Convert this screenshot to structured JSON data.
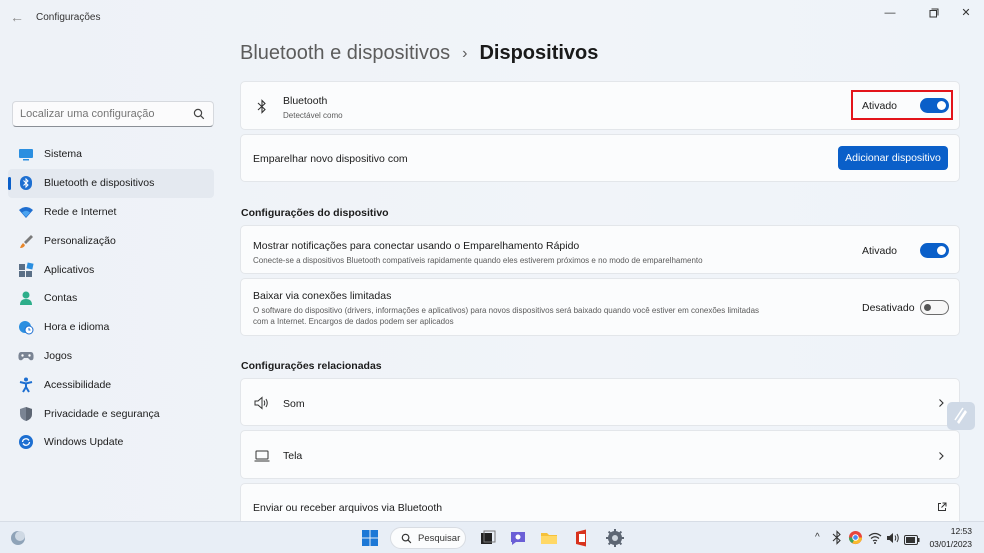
{
  "app": {
    "title": "Configurações"
  },
  "search": {
    "placeholder": "Localizar uma configuração"
  },
  "sidebar": {
    "items": [
      {
        "label": "Sistema",
        "icon": "monitor-icon"
      },
      {
        "label": "Bluetooth e dispositivos",
        "icon": "bluetooth-icon",
        "active": true
      },
      {
        "label": "Rede e Internet",
        "icon": "wifi-icon"
      },
      {
        "label": "Personalização",
        "icon": "brush-icon"
      },
      {
        "label": "Aplicativos",
        "icon": "apps-icon"
      },
      {
        "label": "Contas",
        "icon": "person-icon"
      },
      {
        "label": "Hora e idioma",
        "icon": "globe-clock-icon"
      },
      {
        "label": "Jogos",
        "icon": "gamepad-icon"
      },
      {
        "label": "Acessibilidade",
        "icon": "accessibility-icon"
      },
      {
        "label": "Privacidade e segurança",
        "icon": "shield-icon"
      },
      {
        "label": "Windows Update",
        "icon": "update-icon"
      }
    ]
  },
  "breadcrumb": {
    "parent": "Bluetooth e dispositivos",
    "separator": "›",
    "current": "Dispositivos"
  },
  "bluetooth_card": {
    "title": "Bluetooth",
    "subtitle": "Detectável como",
    "state_label": "Ativado",
    "on": true
  },
  "pair_card": {
    "label": "Emparelhar novo dispositivo com",
    "button": "Adicionar dispositivo"
  },
  "device_settings": {
    "section_title": "Configurações do dispositivo",
    "swift_pair": {
      "title": "Mostrar notificações para conectar usando o Emparelhamento Rápido",
      "subtitle": "Conecte-se a dispositivos Bluetooth compatíveis rapidamente quando eles estiverem próximos e no modo de emparelhamento",
      "state_label": "Ativado",
      "on": true
    },
    "metered": {
      "title": "Baixar via conexões limitadas",
      "subtitle_line1": "O software do dispositivo (drivers, informações e aplicativos) para novos dispositivos será baixado quando você estiver em conexões limitadas",
      "subtitle_line2": "com a Internet. Encargos de dados podem ser aplicados",
      "state_label": "Desativado",
      "on": false
    }
  },
  "related": {
    "section_title": "Configurações relacionadas",
    "items": [
      {
        "label": "Som",
        "icon": "speaker-icon"
      },
      {
        "label": "Tela",
        "icon": "laptop-icon"
      },
      {
        "label": "Enviar ou receber arquivos via Bluetooth",
        "icon": "external-link-icon"
      }
    ]
  },
  "taskbar": {
    "search_label": "Pesquisar",
    "time": "12:53",
    "date": "03/01/2023"
  },
  "colors": {
    "accent": "#0a5fc9",
    "highlight": "#e3141b"
  }
}
